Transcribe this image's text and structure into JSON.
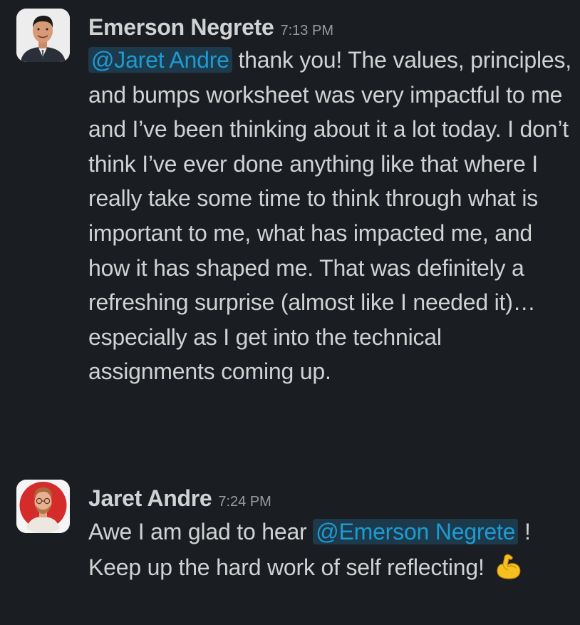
{
  "messages": [
    {
      "author": "Emerson Negrete",
      "time": "7:13 PM",
      "mention": "@Jaret Andre",
      "text_1": " thank you! The values, principles, and bumps worksheet was very impactful to me and I’ve been thinking about it a lot today. I don’t think I’ve ever done anything like that where I really take some time to think through what is important to me, what has impacted me, and how it has shaped me. That was definitely a refreshing surprise (almost like I needed it)… especially as I get into the technical assignments coming up."
    },
    {
      "author": "Jaret Andre",
      "time": "7:24 PM",
      "text_pre": "Awe I am glad to hear ",
      "mention": "@Emerson Negrete",
      "text_post": " ! Keep up the hard work of self reflecting! ",
      "emoji": "flexed-biceps"
    }
  ],
  "colors": {
    "background": "#1a1d21",
    "text": "#d1d2d3",
    "timestamp": "#9a9b9d",
    "mention_text": "#1d9bd1",
    "mention_bg": "#1d3a4d"
  }
}
